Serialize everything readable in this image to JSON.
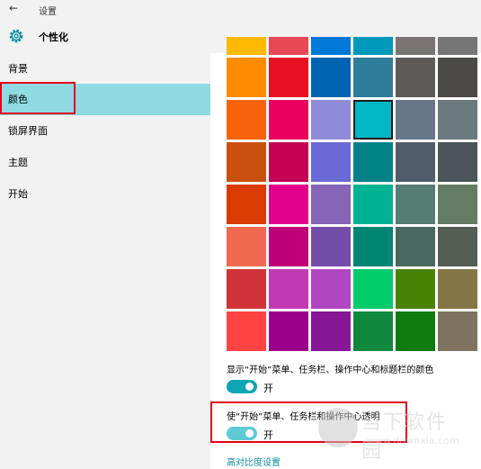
{
  "titlebar": {
    "back_glyph": "←",
    "title": "设置"
  },
  "header": {
    "icon": "gear-icon",
    "title": "个性化"
  },
  "sidebar": {
    "items": [
      {
        "label": "背景",
        "selected": false
      },
      {
        "label": "颜色",
        "selected": true
      },
      {
        "label": "锁屏界面",
        "selected": false
      },
      {
        "label": "主题",
        "selected": false
      },
      {
        "label": "开始",
        "selected": false
      }
    ]
  },
  "accent_colors": [
    [
      "#ff8c00",
      "#e81123",
      "#0063b1",
      "#2d7d9a",
      "#5d5a58",
      "#4c4a48"
    ],
    [
      "#f7630c",
      "#ea005e",
      "#8e8cd8",
      "#00b7c3",
      "#68768a",
      "#69797e"
    ],
    [
      "#ca5010",
      "#c30052",
      "#6b69d6",
      "#038387",
      "#515c6b",
      "#4a5459"
    ],
    [
      "#da3b01",
      "#e3008c",
      "#8764b8",
      "#00b294",
      "#567c73",
      "#647c64"
    ],
    [
      "#ef6950",
      "#bf0077",
      "#744da9",
      "#018574",
      "#486860",
      "#525e54"
    ],
    [
      "#d13438",
      "#c239b3",
      "#b146c2",
      "#00cc6a",
      "#498205",
      "#847545"
    ],
    [
      "#ff4343",
      "#9a0089",
      "#881798",
      "#10893e",
      "#107c10",
      "#7e735f"
    ]
  ],
  "top_strip_colors": [
    "#ffb900",
    "#e74856",
    "#0078d7",
    "#0099bc",
    "#7a7574",
    "#767676"
  ],
  "selected_color": "#00b7c3",
  "options": {
    "show_color_label": "显示“开始”菜单、任务栏、操作中心和标题栏的颜色",
    "show_color_state": "开",
    "transparency_label": "使“开始”菜单、任务栏和操作中心透明",
    "transparency_state": "开",
    "toggle_color": "#0ea5b5",
    "toggle_color_light": "#5ecad5"
  },
  "high_contrast_link": "高对比度设置",
  "watermark": {
    "cn": "当下软件园",
    "url": "www.downxia.com"
  }
}
